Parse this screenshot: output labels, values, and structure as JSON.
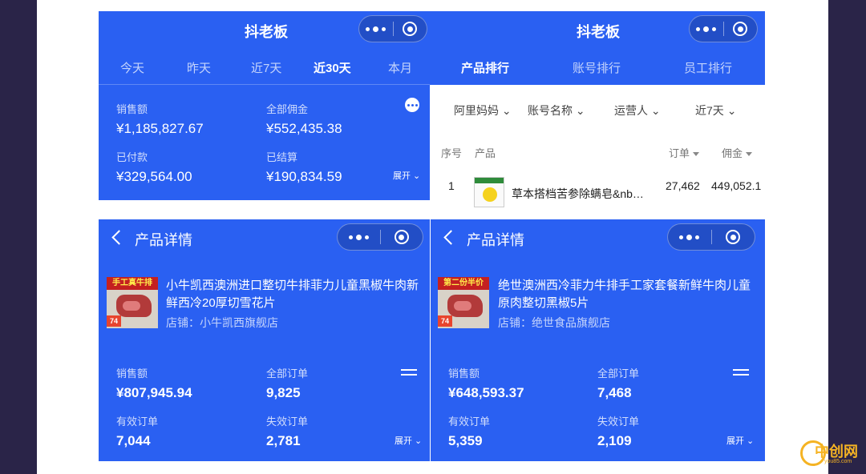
{
  "p1": {
    "title": "抖老板",
    "tabs": [
      "今天",
      "昨天",
      "近7天",
      "近30天",
      "本月"
    ],
    "active_tab": "近30天",
    "stats": [
      {
        "label": "销售额",
        "value": "¥1,185,827.67"
      },
      {
        "label": "全部佣金",
        "value": "¥552,435.38"
      },
      {
        "label": "已付款",
        "value": "¥329,564.00"
      },
      {
        "label": "已结算",
        "value": "¥190,834.59"
      }
    ],
    "expand": "展开"
  },
  "p2": {
    "title": "抖老板",
    "tabs": [
      "产品排行",
      "账号排行",
      "员工排行"
    ],
    "active_tab": "产品排行",
    "filters": [
      "阿里妈妈",
      "账号名称",
      "运营人",
      "近7天"
    ],
    "columns": [
      "序号",
      "产品",
      "订单",
      "佣金"
    ],
    "rows": [
      {
        "index": "1",
        "product": "草本搭档苦参除螨皂&nb…",
        "orders": "27,462",
        "commission": "449,052.1"
      }
    ]
  },
  "p3": {
    "title": "产品详情",
    "product_name": "小牛凯西澳洲进口整切牛排菲力儿童黑椒牛肉新鲜西冷20厚切雪花片",
    "shop": "店铺：小牛凯西旗舰店",
    "thumb_banner": "手工真牛排",
    "thumb_price": "74",
    "stats": [
      {
        "label": "销售额",
        "value": "¥807,945.94"
      },
      {
        "label": "全部订单",
        "value": "9,825"
      },
      {
        "label": "有效订单",
        "value": "7,044"
      },
      {
        "label": "失效订单",
        "value": "2,781"
      }
    ],
    "expand": "展开"
  },
  "p4": {
    "title": "产品详情",
    "product_name": "绝世澳洲西冷菲力牛排手工家套餐新鲜牛肉儿童原肉整切黑椒5片",
    "shop": "店铺：绝世食品旗舰店",
    "thumb_banner": "第二份半价",
    "thumb_price": "74",
    "stats": [
      {
        "label": "销售额",
        "value": "¥648,593.37"
      },
      {
        "label": "全部订单",
        "value": "7,468"
      },
      {
        "label": "有效订单",
        "value": "5,359"
      },
      {
        "label": "失效订单",
        "value": "2,109"
      }
    ],
    "expand": "展开"
  },
  "watermark": {
    "text": "中创网",
    "sub": "you85.com"
  },
  "colors": {
    "accent": "#2a60f2",
    "frame": "#2a2448",
    "watermark": "#f5b323"
  }
}
